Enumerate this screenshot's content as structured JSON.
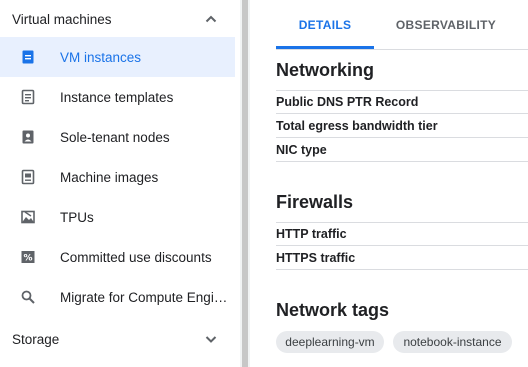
{
  "sidebar": {
    "section1": {
      "title": "Virtual machines"
    },
    "items": [
      {
        "label": "VM instances",
        "icon": "vm-instance-icon"
      },
      {
        "label": "Instance templates",
        "icon": "template-icon"
      },
      {
        "label": "Sole-tenant nodes",
        "icon": "sole-tenant-icon"
      },
      {
        "label": "Machine images",
        "icon": "machine-image-icon"
      },
      {
        "label": "TPUs",
        "icon": "tpu-icon"
      },
      {
        "label": "Committed use discounts",
        "icon": "percent-icon"
      },
      {
        "label": "Migrate for Compute Engi…",
        "icon": "search-icon"
      }
    ],
    "section2": {
      "title": "Storage"
    }
  },
  "tabs": [
    {
      "label": "DETAILS",
      "active": true
    },
    {
      "label": "OBSERVABILITY",
      "active": false
    }
  ],
  "networking": {
    "title": "Networking",
    "rows": [
      "Public DNS PTR Record",
      "Total egress bandwidth tier",
      "NIC type"
    ]
  },
  "firewalls": {
    "title": "Firewalls",
    "rows": [
      "HTTP traffic",
      "HTTPS traffic"
    ]
  },
  "network_tags": {
    "title": "Network tags",
    "tags": [
      "deeplearning-vm",
      "notebook-instance"
    ]
  },
  "colors": {
    "accent": "#1a73e8",
    "active_bg": "#e8f0fe",
    "icon_gray": "#5f6368"
  }
}
